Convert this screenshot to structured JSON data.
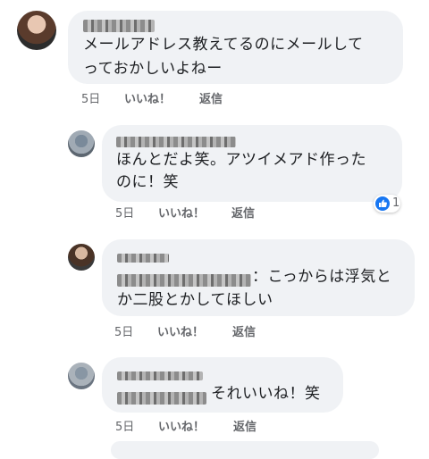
{
  "comments": [
    {
      "text_line1": "メールアドレス教えてるのにメールして",
      "text_line2": "っておかしいよねー",
      "time": "5日",
      "like": "いいね！",
      "reply": "返信"
    },
    {
      "text_line1": "ほんとだよ笑。アツイメアド作った",
      "text_line2": "のに！笑",
      "time": "5日",
      "like": "いいね！",
      "reply": "返信",
      "reaction_count": "1"
    },
    {
      "text_line1": "：こっからは浮気と",
      "text_line2": "か二股とかしてほしい",
      "time": "5日",
      "like": "いいね！",
      "reply": "返信"
    },
    {
      "text_line1": "それいいね！笑",
      "time": "5日",
      "like": "いいね！",
      "reply": "返信"
    }
  ],
  "colors": {
    "bubble": "#f0f2f5",
    "meta": "#65676b",
    "like_blue": "#1877f2"
  },
  "icons": {
    "reaction": "thumbs-up-icon"
  }
}
